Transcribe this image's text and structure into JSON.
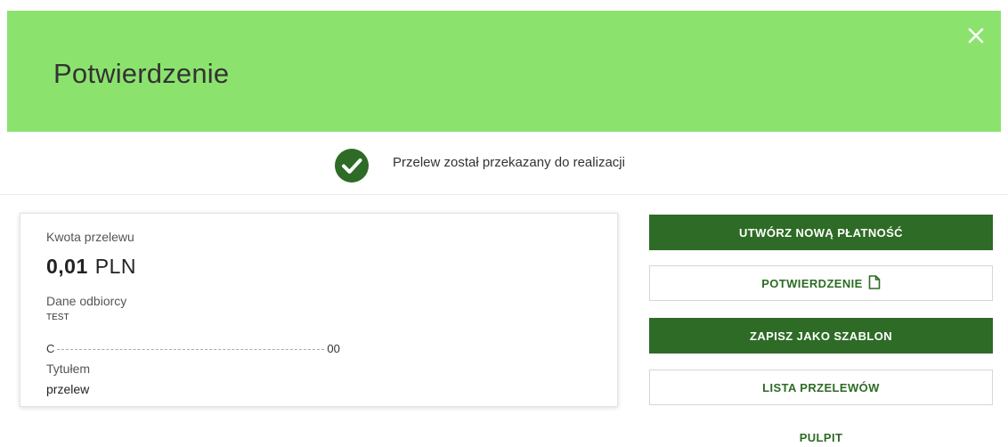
{
  "header": {
    "title": "Potwierdzenie",
    "close_icon": "close-icon",
    "color": "#8be36e"
  },
  "status": {
    "icon": "check-circle-icon",
    "message": "Przelew został przekazany do realizacji"
  },
  "summary": {
    "amount_label": "Kwota przelewu",
    "amount_value": "0,01",
    "amount_currency": "PLN",
    "recipient_label": "Dane odbiorcy",
    "recipient_name": "TEST",
    "account_start": "C",
    "account_end": "00",
    "title_label": "Tytułem",
    "title_value": "przelew"
  },
  "actions": {
    "new_payment": "UTWÓRZ NOWĄ PŁATNOŚĆ",
    "confirmation": "POTWIERDZENIE",
    "save_template": "ZAPISZ JAKO SZABLON",
    "transfer_list": "LISTA PRZELEWÓW",
    "dashboard": "PULPIT"
  },
  "colors": {
    "primary": "#2e6b26",
    "header": "#8be36e"
  }
}
